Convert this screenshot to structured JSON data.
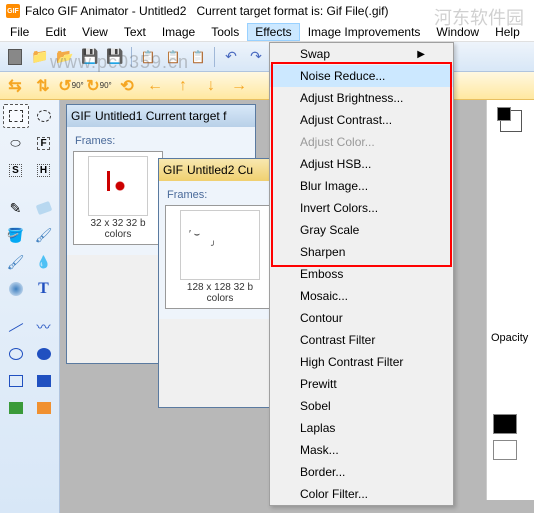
{
  "title": {
    "app": "Falco GIF Animator",
    "doc": "Untitled2",
    "format": "Current target format is: Gif File(.gif)"
  },
  "menu": {
    "file": "File",
    "edit": "Edit",
    "view": "View",
    "text": "Text",
    "image": "Image",
    "tools": "Tools",
    "effects": "Effects",
    "improvements": "Image Improvements",
    "window": "Window",
    "help": "Help"
  },
  "watermark": "www.pc0359.cn",
  "watermark2": "河东软件园",
  "toolbar2": {
    "rot90a": "90°",
    "rot90b": "90°"
  },
  "child1": {
    "title": "Untitled1   Current target f",
    "frames": "Frames:",
    "info1": "32 x 32 32 b",
    "info2": "colors"
  },
  "child2": {
    "title": "Untitled2   Cu",
    "frames": "Frames:",
    "info1": "128 x 128 32 b",
    "info2": "colors"
  },
  "effects_menu": {
    "swap": "Swap",
    "noise": "Noise Reduce...",
    "brightness": "Adjust Brightness...",
    "contrast": "Adjust Contrast...",
    "color": "Adjust Color...",
    "hsb": "Adjust HSB...",
    "blur": "Blur Image...",
    "invert": "Invert Colors...",
    "gray": "Gray Scale",
    "sharpen": "Sharpen",
    "emboss": "Emboss",
    "mosaic": "Mosaic...",
    "contour": "Contour",
    "contrast_filter": "Contrast Filter",
    "high_contrast": "High Contrast Filter",
    "prewitt": "Prewitt",
    "sobel": "Sobel",
    "laplas": "Laplas",
    "mask": "Mask...",
    "border": "Border...",
    "color_filter": "Color Filter..."
  },
  "right": {
    "opacity": "Opacity"
  }
}
